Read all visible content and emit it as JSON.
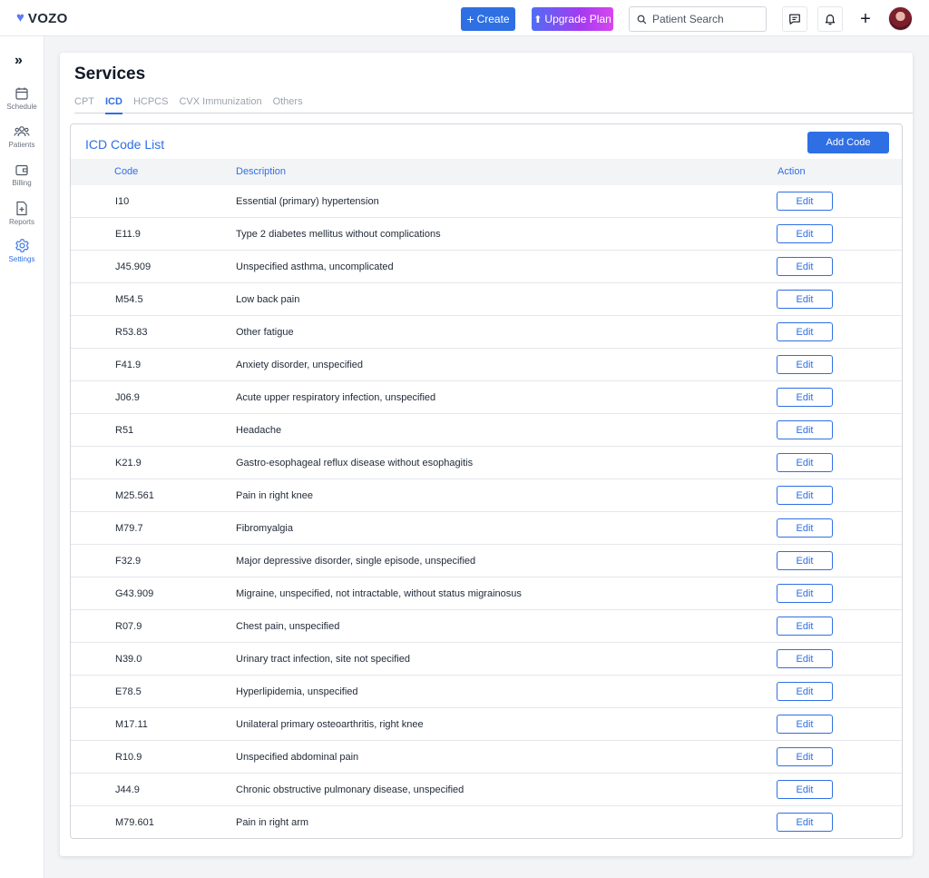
{
  "topbar": {
    "brand": "VOZO",
    "create_label": "Create",
    "upgrade_label": "Upgrade Plan",
    "search_placeholder": "Patient Search"
  },
  "sidebar": {
    "items": [
      {
        "label": "Schedule",
        "icon": "calendar-icon"
      },
      {
        "label": "Patients",
        "icon": "users-icon"
      },
      {
        "label": "Billing",
        "icon": "wallet-icon"
      },
      {
        "label": "Reports",
        "icon": "report-icon"
      },
      {
        "label": "Settings",
        "icon": "gear-icon",
        "active": true
      }
    ]
  },
  "page": {
    "title": "Services",
    "tabs": [
      "CPT",
      "ICD",
      "HCPCS",
      "CVX Immunization",
      "Others"
    ],
    "active_tab": "ICD"
  },
  "list": {
    "title": "ICD Code List",
    "add_label": "Add Code",
    "columns": {
      "code": "Code",
      "description": "Description",
      "action": "Action"
    },
    "edit_label": "Edit",
    "rows": [
      {
        "code": "I10",
        "description": "Essential (primary) hypertension"
      },
      {
        "code": "E11.9",
        "description": "Type 2 diabetes mellitus without complications"
      },
      {
        "code": "J45.909",
        "description": "Unspecified asthma, uncomplicated"
      },
      {
        "code": "M54.5",
        "description": "Low back pain"
      },
      {
        "code": "R53.83",
        "description": "Other fatigue"
      },
      {
        "code": "F41.9",
        "description": "Anxiety disorder, unspecified"
      },
      {
        "code": "J06.9",
        "description": "Acute upper respiratory infection, unspecified"
      },
      {
        "code": "R51",
        "description": "Headache"
      },
      {
        "code": "K21.9",
        "description": "Gastro-esophageal reflux disease without esophagitis"
      },
      {
        "code": "M25.561",
        "description": "Pain in right knee"
      },
      {
        "code": "M79.7",
        "description": "Fibromyalgia"
      },
      {
        "code": "F32.9",
        "description": "Major depressive disorder, single episode, unspecified"
      },
      {
        "code": "G43.909",
        "description": "Migraine, unspecified, not intractable, without status migrainosus"
      },
      {
        "code": "R07.9",
        "description": "Chest pain, unspecified"
      },
      {
        "code": "N39.0",
        "description": "Urinary tract infection, site not specified"
      },
      {
        "code": "E78.5",
        "description": "Hyperlipidemia, unspecified"
      },
      {
        "code": "M17.11",
        "description": "Unilateral primary osteoarthritis, right knee"
      },
      {
        "code": "R10.9",
        "description": "Unspecified abdominal pain"
      },
      {
        "code": "J44.9",
        "description": "Chronic obstructive pulmonary disease, unspecified"
      },
      {
        "code": "M79.601",
        "description": "Pain in right arm"
      }
    ]
  },
  "colors": {
    "primary": "#2f6fe4",
    "brand_heart": "#5b7cf7"
  }
}
